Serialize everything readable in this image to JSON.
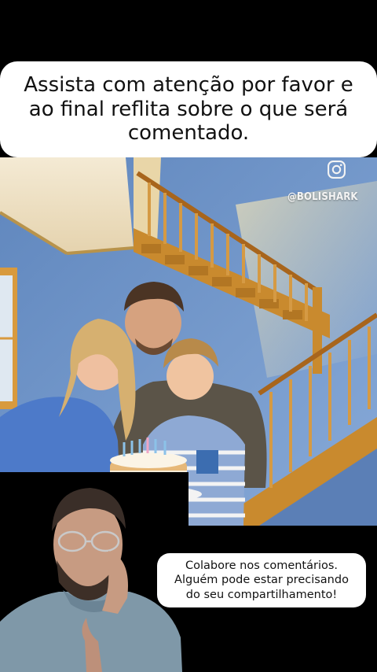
{
  "video": {
    "top_caption": "Assista com atenção por favor e ao final reflita sobre o que será comentado.",
    "watermark_handle": "@BOLISHARK",
    "watermark_icon": "instagram-icon",
    "reply_caption": "Colabore nos comentários.\nAlguém pode estar precisando\ndo seu compartilhamento!"
  },
  "colors": {
    "background": "#000000",
    "caption_bg": "#ffffff",
    "wall_blue": "#6f94c7",
    "stair_wood": "#c98a2e"
  }
}
